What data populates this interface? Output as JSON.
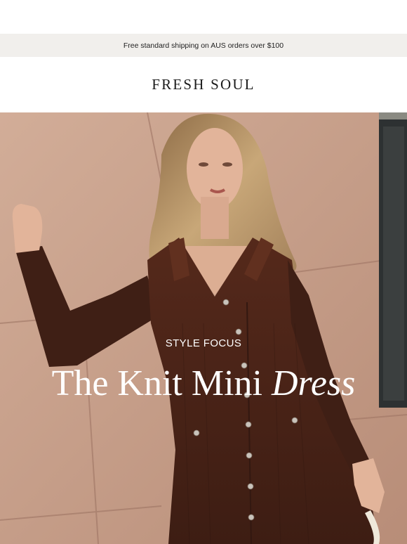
{
  "announcement": {
    "text": "Free standard shipping on AUS orders over $100"
  },
  "brand": {
    "name": "FRESH SOUL"
  },
  "hero": {
    "image_icon": "model-in-brown-knit-dress-photo",
    "kicker": "STYLE FOCUS",
    "headline_main": "The Knit Mini ",
    "headline_emphasis": "Dress"
  },
  "colors": {
    "announcement_bg": "#f1efec",
    "wall": "#c9a48f",
    "dress": "#4a2418",
    "hair": "#b08a5f",
    "skin": "#e2b49a"
  }
}
